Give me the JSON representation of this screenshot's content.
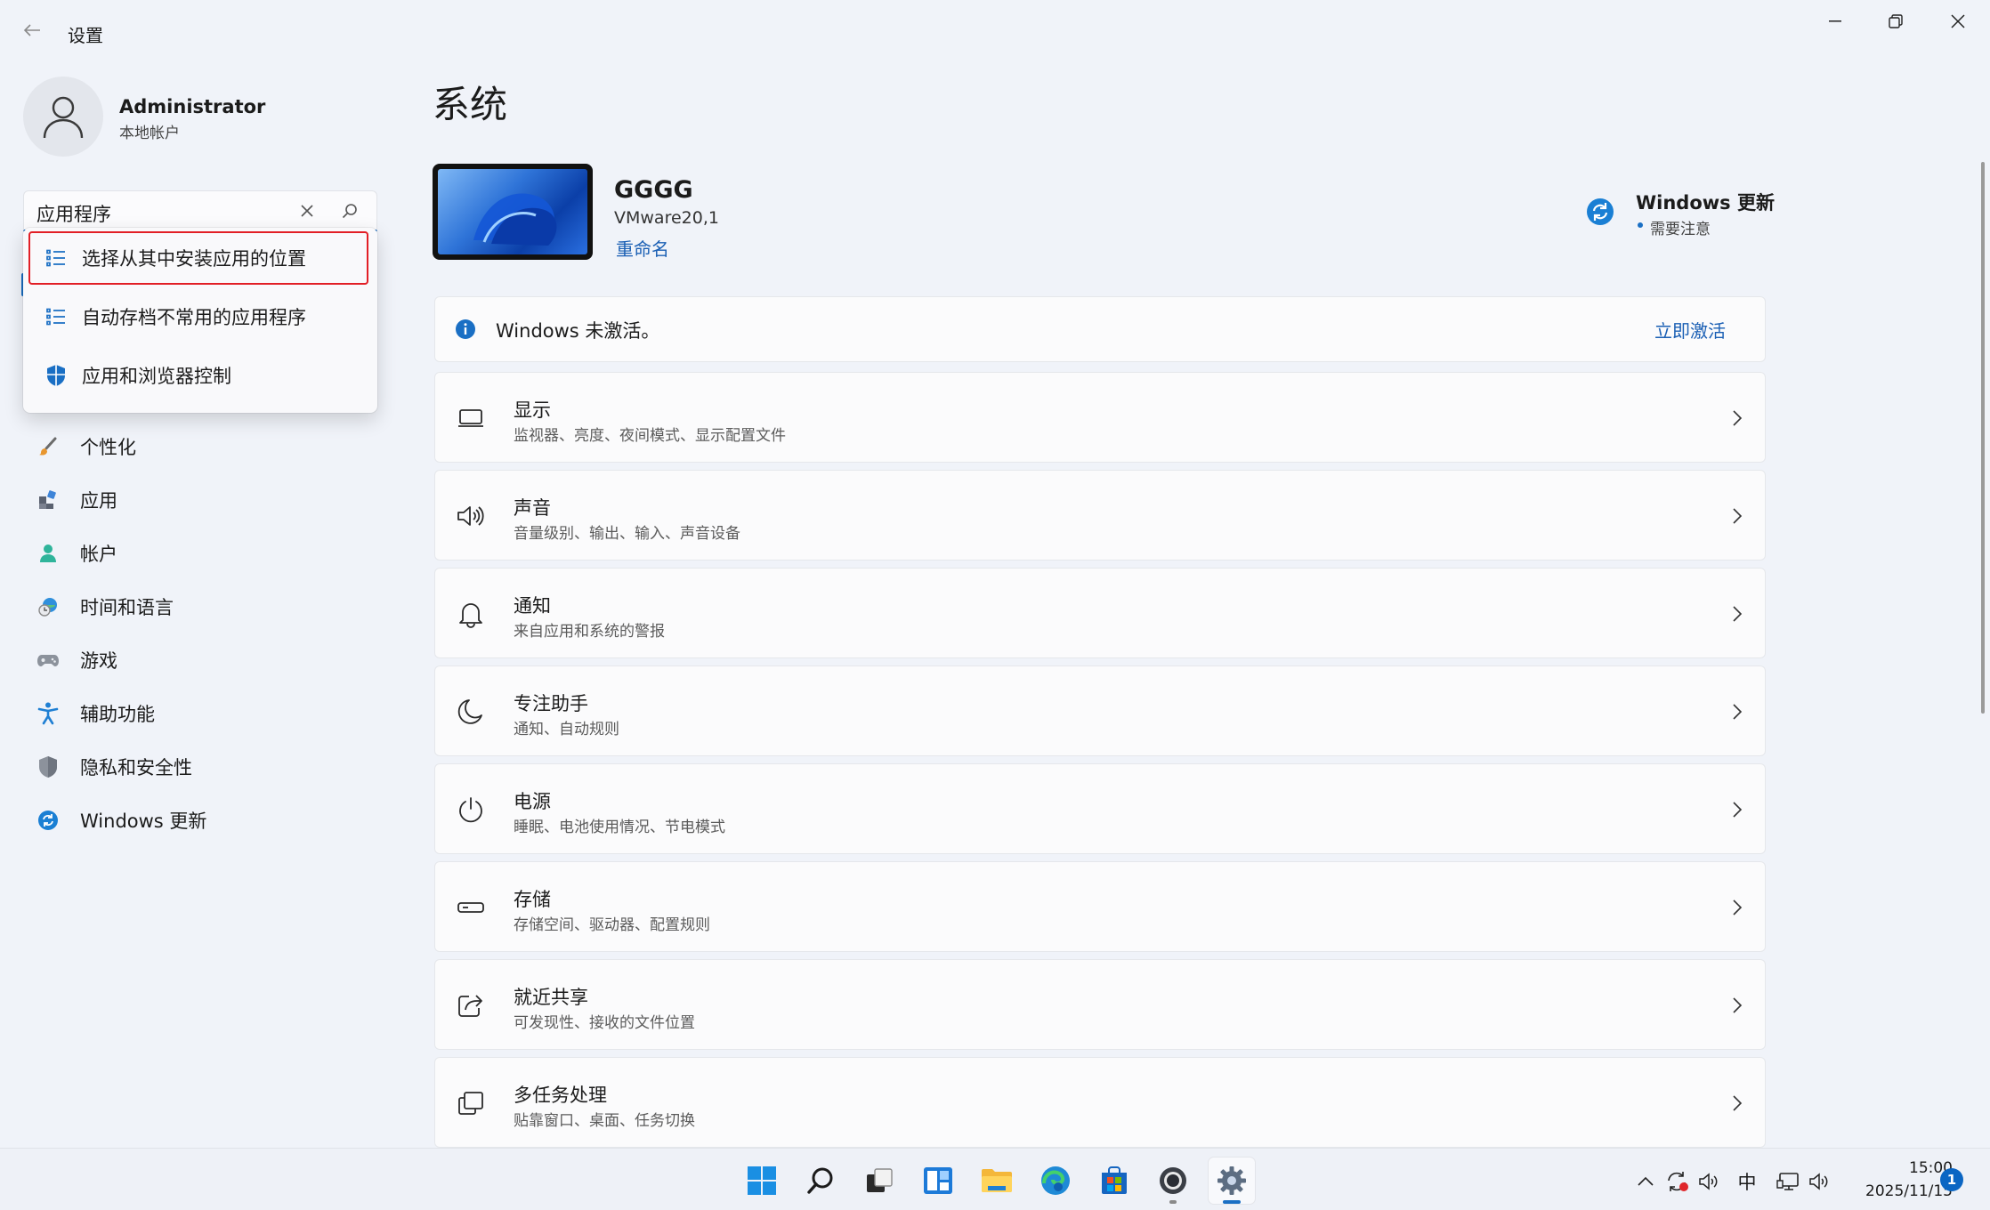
{
  "window": {
    "title": "设置"
  },
  "user": {
    "name": "Administrator",
    "account_type": "本地帐户"
  },
  "search": {
    "value": "应用程序",
    "suggestions": [
      {
        "label": "选择从其中安装应用的位置",
        "icon": "list-icon"
      },
      {
        "label": "自动存档不常用的应用程序",
        "icon": "list-icon"
      },
      {
        "label": "应用和浏览器控制",
        "icon": "shield-icon"
      }
    ]
  },
  "sidebar": {
    "items": [
      {
        "label": "个性化",
        "icon": "brush-icon"
      },
      {
        "label": "应用",
        "icon": "apps-icon"
      },
      {
        "label": "帐户",
        "icon": "person-icon"
      },
      {
        "label": "时间和语言",
        "icon": "globe-clock-icon"
      },
      {
        "label": "游戏",
        "icon": "gamepad-icon"
      },
      {
        "label": "辅助功能",
        "icon": "accessibility-icon"
      },
      {
        "label": "隐私和安全性",
        "icon": "shield-gray-icon"
      },
      {
        "label": "Windows 更新",
        "icon": "update-icon"
      }
    ]
  },
  "main": {
    "title": "系统",
    "device": {
      "name": "GGGG",
      "model": "VMware20,1",
      "rename_label": "重命名"
    },
    "windows_update": {
      "title": "Windows 更新",
      "status": "需要注意"
    },
    "activation": {
      "message": "Windows 未激活。",
      "action": "立即激活"
    },
    "settings": [
      {
        "title": "显示",
        "subtitle": "监视器、亮度、夜间模式、显示配置文件",
        "icon": "monitor-icon"
      },
      {
        "title": "声音",
        "subtitle": "音量级别、输出、输入、声音设备",
        "icon": "speaker-icon"
      },
      {
        "title": "通知",
        "subtitle": "来自应用和系统的警报",
        "icon": "bell-icon"
      },
      {
        "title": "专注助手",
        "subtitle": "通知、自动规则",
        "icon": "moon-icon"
      },
      {
        "title": "电源",
        "subtitle": "睡眠、电池使用情况、节电模式",
        "icon": "power-icon"
      },
      {
        "title": "存储",
        "subtitle": "存储空间、驱动器、配置规则",
        "icon": "storage-icon"
      },
      {
        "title": "就近共享",
        "subtitle": "可发现性、接收的文件位置",
        "icon": "share-icon"
      },
      {
        "title": "多任务处理",
        "subtitle": "贴靠窗口、桌面、任务切换",
        "icon": "multitask-icon"
      }
    ]
  },
  "taskbar": {
    "apps": [
      "start-icon",
      "search-icon",
      "task-view-icon",
      "widgets-icon",
      "file-explorer-icon",
      "edge-icon",
      "store-icon",
      "camera-app-icon",
      "settings-icon"
    ],
    "tray": {
      "ime": "中"
    },
    "clock": {
      "time": "15:00",
      "date": "2025/11/15"
    },
    "notifications": "1"
  },
  "colors": {
    "accent": "#1a6fc4",
    "highlight": "#e21f26",
    "background": "#f0f3f9"
  }
}
